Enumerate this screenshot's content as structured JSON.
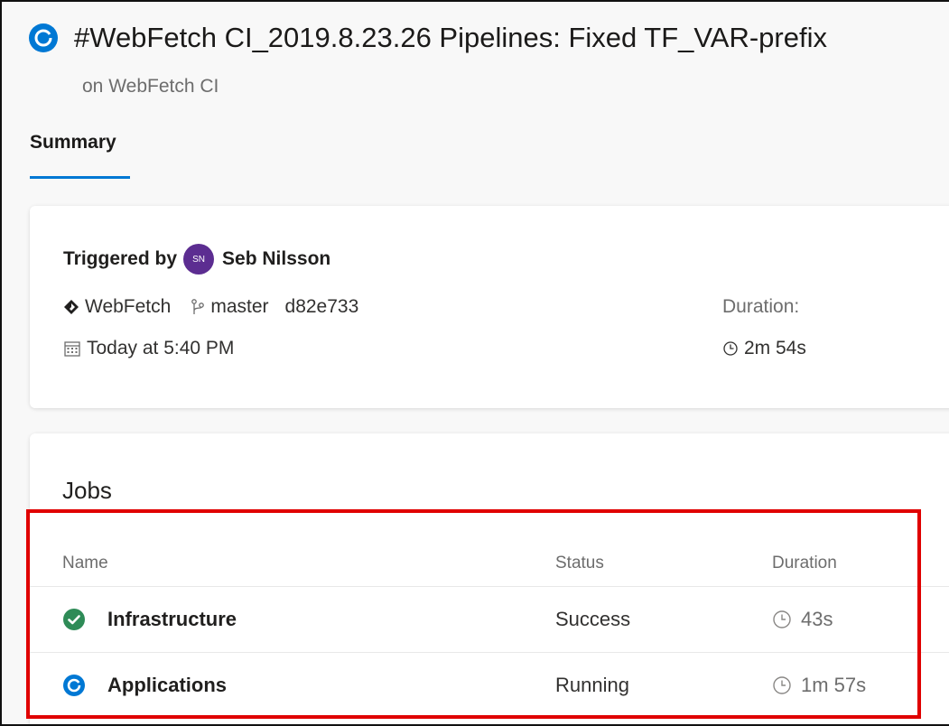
{
  "header": {
    "title": "#WebFetch CI_2019.8.23.26 Pipelines: Fixed TF_VAR-prefix",
    "subtitle": "on WebFetch CI",
    "status_icon": "running-icon",
    "accent_color": "#0078d4"
  },
  "tabs": [
    {
      "label": "Summary",
      "selected": true
    }
  ],
  "summary": {
    "triggered_label": "Triggered by",
    "avatar_initials": "SN",
    "user_name": "Seb Nilsson",
    "repo": "WebFetch",
    "branch": "master",
    "commit": "d82e733",
    "date": "Today at 5:40 PM",
    "duration_label": "Duration:",
    "duration_value": "2m 54s"
  },
  "jobs": {
    "title": "Jobs",
    "columns": [
      "Name",
      "Status",
      "Duration"
    ],
    "rows": [
      {
        "name": "Infrastructure",
        "status": "Success",
        "duration": "43s",
        "icon": "success-check-icon",
        "icon_color": "#2e8b57"
      },
      {
        "name": "Applications",
        "status": "Running",
        "duration": "1m 57s",
        "icon": "running-icon",
        "icon_color": "#0078d4"
      }
    ]
  },
  "highlight_color": "#e00000"
}
